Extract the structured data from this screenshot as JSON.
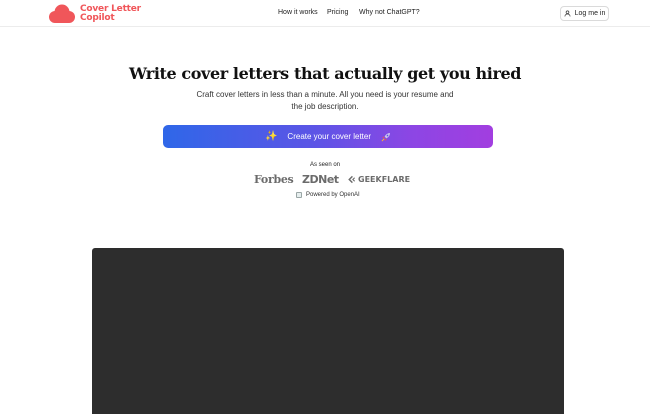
{
  "brand": {
    "line1": "Cover Letter",
    "line2": "Copilot",
    "color": "#f0565a"
  },
  "nav": {
    "links": [
      "How it works",
      "Pricing",
      "Why not ChatGPT?"
    ],
    "login_label": "Log me in",
    "login_icon": "user-icon"
  },
  "hero": {
    "title": "Write cover letters that actually get you hired",
    "subtitle": "Craft cover letters in less than a minute. All you need is your resume and the job description.",
    "cta_label": "Create your cover letter",
    "cta_icons": [
      "sparkles-icon",
      "rocket-icon"
    ],
    "cta_gradient": [
      "#2f67e8",
      "#a23ee0"
    ]
  },
  "press": {
    "label": "As seen on",
    "brands": [
      "Forbes",
      "ZDNet",
      "GEEKFLARE"
    ]
  },
  "powered_by": "Powered by OpenAI",
  "video": {
    "background": "#2d2d2d"
  }
}
